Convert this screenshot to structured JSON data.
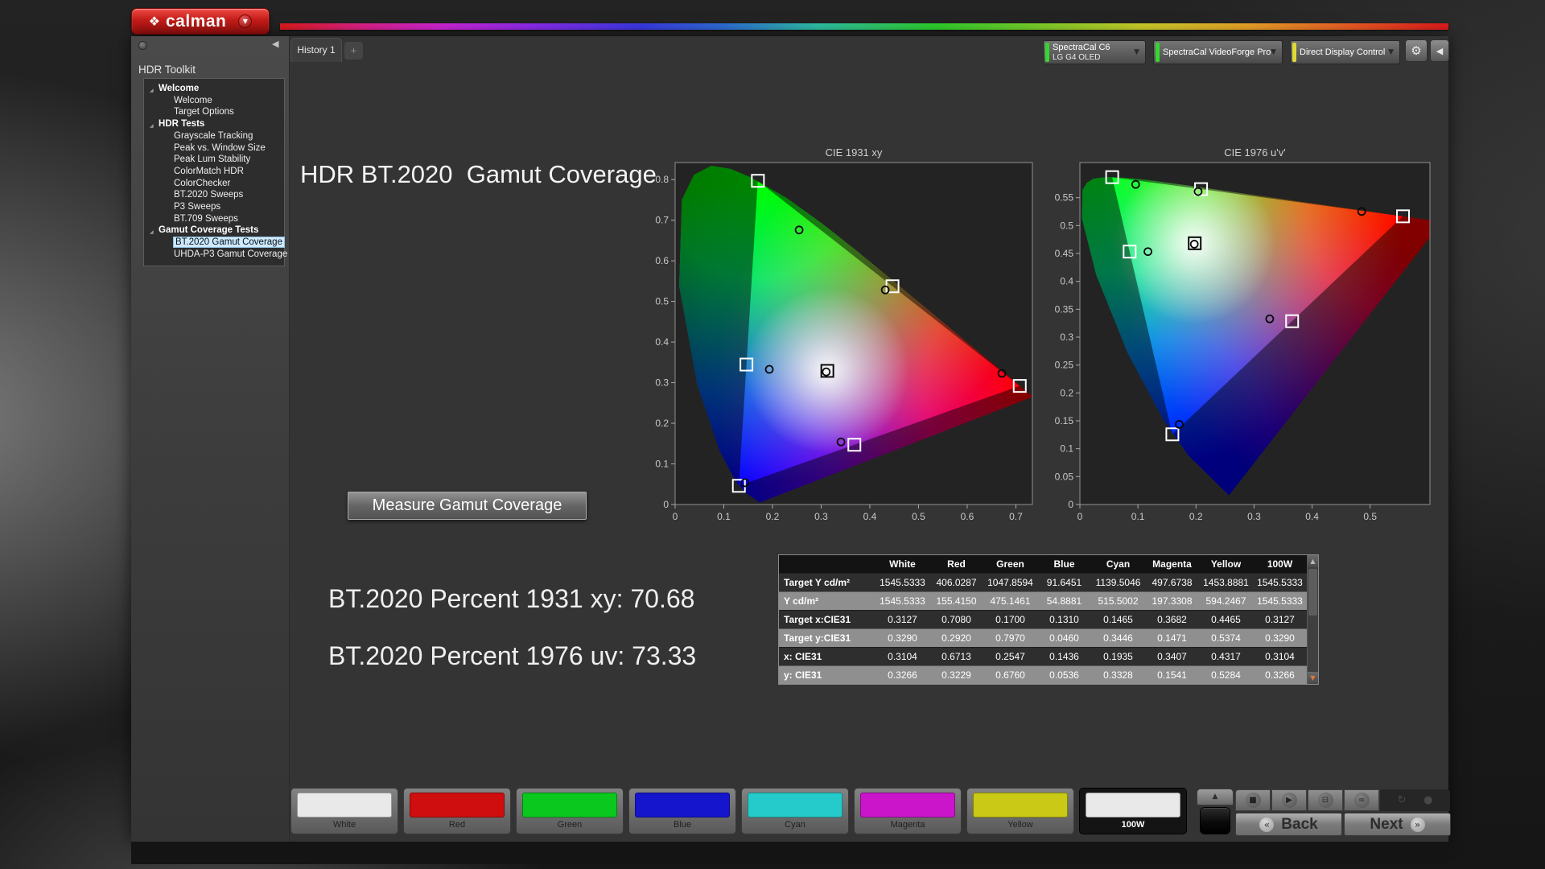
{
  "icons": {
    "logo": "❖",
    "dropdown": "▼",
    "collapse_left": "◀",
    "gear": "⚙",
    "add_tab": "+",
    "expander": "◢",
    "scroll_up": "▲",
    "scroll_down": "▼",
    "up_arrow": "▲",
    "back_chevrons": "«",
    "next_chevrons": "»"
  },
  "app": {
    "logo_text": "calman"
  },
  "tabs": {
    "history_tab": "History 1"
  },
  "meters": [
    {
      "label": "SpectraCal C6",
      "sublabel": "LG G4 OLED",
      "status_color": "#35d62f"
    },
    {
      "label": "SpectraCal VideoForge Pro",
      "sublabel": "",
      "status_color": "#35d62f"
    },
    {
      "label": "Direct Display Control",
      "sublabel": "",
      "status_color": "#e0da35"
    }
  ],
  "sidebar": {
    "title": "HDR Toolkit",
    "groups": [
      {
        "label": "Welcome",
        "items": [
          {
            "label": "Welcome"
          },
          {
            "label": "Target Options"
          }
        ]
      },
      {
        "label": "HDR Tests",
        "items": [
          {
            "label": "Grayscale Tracking"
          },
          {
            "label": "Peak vs. Window Size"
          },
          {
            "label": "Peak Lum Stability"
          },
          {
            "label": "ColorMatch HDR"
          },
          {
            "label": "ColorChecker"
          },
          {
            "label": "BT.2020 Sweeps"
          },
          {
            "label": "P3 Sweeps"
          },
          {
            "label": "BT.709 Sweeps"
          }
        ]
      },
      {
        "label": "Gamut Coverage Tests",
        "items": [
          {
            "label": "BT.2020 Gamut Coverage",
            "selected": true
          },
          {
            "label": "UHDA-P3 Gamut Coverage"
          }
        ]
      }
    ]
  },
  "main": {
    "title": "HDR BT.2020  Gamut Coverage",
    "measure_button": "Measure Gamut Coverage",
    "result_1931": "BT.2020 Percent 1931 xy: 70.68",
    "result_1976": "BT.2020 Percent 1976 uv: 73.33"
  },
  "chart_data": [
    {
      "type": "scatter",
      "name": "cie-1931-xy",
      "title": "CIE 1931 xy",
      "coverage_percent": 70.68,
      "xlim": [
        0,
        0.734
      ],
      "ylim": [
        0,
        0.842
      ],
      "x_ticks": [
        0,
        0.1,
        0.2,
        0.3,
        0.4,
        0.5,
        0.6,
        0.7
      ],
      "y_ticks": [
        0,
        0.1,
        0.2,
        0.3,
        0.4,
        0.5,
        0.6,
        0.7,
        0.8
      ],
      "gamut_triangle": {
        "red": [
          0.708,
          0.292
        ],
        "green": [
          0.17,
          0.797
        ],
        "blue": [
          0.131,
          0.046
        ]
      },
      "locus": [
        [
          0.1741,
          0.005
        ],
        [
          0.144,
          0.0297
        ],
        [
          0.1241,
          0.0578
        ],
        [
          0.0913,
          0.1327
        ],
        [
          0.0454,
          0.295
        ],
        [
          0.0082,
          0.5384
        ],
        [
          0.0139,
          0.7502
        ],
        [
          0.0389,
          0.812
        ],
        [
          0.0743,
          0.8338
        ],
        [
          0.1142,
          0.8262
        ],
        [
          0.1547,
          0.8059
        ],
        [
          0.2296,
          0.7543
        ],
        [
          0.3016,
          0.6923
        ],
        [
          0.3731,
          0.6245
        ],
        [
          0.4441,
          0.5547
        ],
        [
          0.5125,
          0.4866
        ],
        [
          0.5752,
          0.4242
        ],
        [
          0.627,
          0.3725
        ],
        [
          0.6658,
          0.334
        ],
        [
          0.6915,
          0.3083
        ],
        [
          0.714,
          0.2859
        ],
        [
          0.7347,
          0.2653
        ]
      ],
      "series": [
        {
          "name": "targets",
          "marker": "square",
          "points": [
            [
              0.3127,
              0.329
            ],
            [
              0.708,
              0.292
            ],
            [
              0.17,
              0.797
            ],
            [
              0.131,
              0.046
            ],
            [
              0.1465,
              0.3446
            ],
            [
              0.3682,
              0.1471
            ],
            [
              0.4465,
              0.5374
            ]
          ]
        },
        {
          "name": "measured",
          "marker": "circle",
          "points": [
            [
              0.3104,
              0.3266
            ],
            [
              0.6713,
              0.3229
            ],
            [
              0.2547,
              0.676
            ],
            [
              0.1436,
              0.0536
            ],
            [
              0.1935,
              0.3328
            ],
            [
              0.3407,
              0.1541
            ],
            [
              0.4317,
              0.5284
            ]
          ]
        }
      ]
    },
    {
      "type": "scatter",
      "name": "cie-1976-uv",
      "title": "CIE 1976 u'v'",
      "coverage_percent": 73.33,
      "xlim": [
        0,
        0.603
      ],
      "ylim": [
        0,
        0.613
      ],
      "x_ticks": [
        0,
        0.1,
        0.2,
        0.3,
        0.4,
        0.5
      ],
      "y_ticks": [
        0,
        0.05,
        0.1,
        0.15,
        0.2,
        0.25,
        0.3,
        0.35,
        0.4,
        0.45,
        0.5,
        0.55
      ],
      "gamut_triangle": {
        "red": [
          0.5566,
          0.5166
        ],
        "green": [
          0.0556,
          0.5868
        ],
        "blue": [
          0.1593,
          0.1258
        ]
      },
      "locus": [
        [
          0.2568,
          0.0166
        ],
        [
          0.1877,
          0.0871
        ],
        [
          0.1441,
          0.151
        ],
        [
          0.0828,
          0.2708
        ],
        [
          0.0282,
          0.4117
        ],
        [
          0.0035,
          0.5131
        ],
        [
          0.0046,
          0.5639
        ],
        [
          0.0123,
          0.577
        ],
        [
          0.0231,
          0.5837
        ],
        [
          0.036,
          0.5861
        ],
        [
          0.0501,
          0.5868
        ],
        [
          0.0792,
          0.5856
        ],
        [
          0.1127,
          0.5821
        ],
        [
          0.1531,
          0.5766
        ],
        [
          0.2026,
          0.5694
        ],
        [
          0.2623,
          0.5604
        ],
        [
          0.3315,
          0.5501
        ],
        [
          0.4035,
          0.5393
        ],
        [
          0.4692,
          0.5295
        ],
        [
          0.5203,
          0.5219
        ],
        [
          0.5709,
          0.5143
        ],
        [
          0.6234,
          0.5065
        ]
      ],
      "series": [
        {
          "name": "targets",
          "marker": "square",
          "points": [
            [
              0.1978,
              0.4683
            ],
            [
              0.5566,
              0.5166
            ],
            [
              0.0556,
              0.5868
            ],
            [
              0.1593,
              0.1258
            ],
            [
              0.0857,
              0.4533
            ],
            [
              0.3656,
              0.3286
            ],
            [
              0.2087,
              0.5653
            ]
          ]
        },
        {
          "name": "measured",
          "marker": "circle",
          "points": [
            [
              0.1971,
              0.4667
            ],
            [
              0.4854,
              0.5253
            ],
            [
              0.0961,
              0.5738
            ],
            [
              0.1712,
              0.1437
            ],
            [
              0.1172,
              0.4533
            ],
            [
              0.327,
              0.3328
            ],
            [
              0.2037,
              0.561
            ]
          ]
        }
      ]
    }
  ],
  "table": {
    "columns": [
      "White",
      "Red",
      "Green",
      "Blue",
      "Cyan",
      "Magenta",
      "Yellow",
      "100W"
    ],
    "rows": [
      {
        "label": "Target Y cd/m²",
        "values": [
          "1545.5333",
          "406.0287",
          "1047.8594",
          "91.6451",
          "1139.5046",
          "497.6738",
          "1453.8881",
          "1545.5333"
        ]
      },
      {
        "label": "Y cd/m²",
        "values": [
          "1545.5333",
          "155.4150",
          "475.1461",
          "54.8881",
          "515.5002",
          "197.3308",
          "594.2467",
          "1545.5333"
        ]
      },
      {
        "label": "Target x:CIE31",
        "values": [
          "0.3127",
          "0.7080",
          "0.1700",
          "0.1310",
          "0.1465",
          "0.3682",
          "0.4465",
          "0.3127"
        ]
      },
      {
        "label": "Target y:CIE31",
        "values": [
          "0.3290",
          "0.2920",
          "0.7970",
          "0.0460",
          "0.3446",
          "0.1471",
          "0.5374",
          "0.3290"
        ]
      },
      {
        "label": "x: CIE31",
        "values": [
          "0.3104",
          "0.6713",
          "0.2547",
          "0.1436",
          "0.1935",
          "0.3407",
          "0.4317",
          "0.3104"
        ]
      },
      {
        "label": "y: CIE31",
        "values": [
          "0.3266",
          "0.3229",
          "0.6760",
          "0.0536",
          "0.3328",
          "0.1541",
          "0.5284",
          "0.3266"
        ]
      }
    ]
  },
  "patterns": [
    {
      "label": "White",
      "color": "#e9e9e9"
    },
    {
      "label": "Red",
      "color": "#cf0f0f"
    },
    {
      "label": "Green",
      "color": "#0bc81e"
    },
    {
      "label": "Blue",
      "color": "#1515cd"
    },
    {
      "label": "Cyan",
      "color": "#25cbcb"
    },
    {
      "label": "Magenta",
      "color": "#cb15cb"
    },
    {
      "label": "Yellow",
      "color": "#c9c916"
    },
    {
      "label": "100W",
      "color": "#e9e9e9",
      "selected": true
    }
  ],
  "transport": {
    "buttons": [
      {
        "name": "stop",
        "glyph": "■"
      },
      {
        "name": "play",
        "glyph": "▶"
      },
      {
        "name": "pattern-window",
        "glyph": "⊟"
      },
      {
        "name": "loop",
        "glyph": "∞"
      }
    ],
    "dim_buttons": [
      {
        "name": "refresh",
        "glyph": "↻"
      },
      {
        "name": "record",
        "glyph": "●"
      }
    ],
    "back_label": "Back",
    "next_label": "Next"
  }
}
